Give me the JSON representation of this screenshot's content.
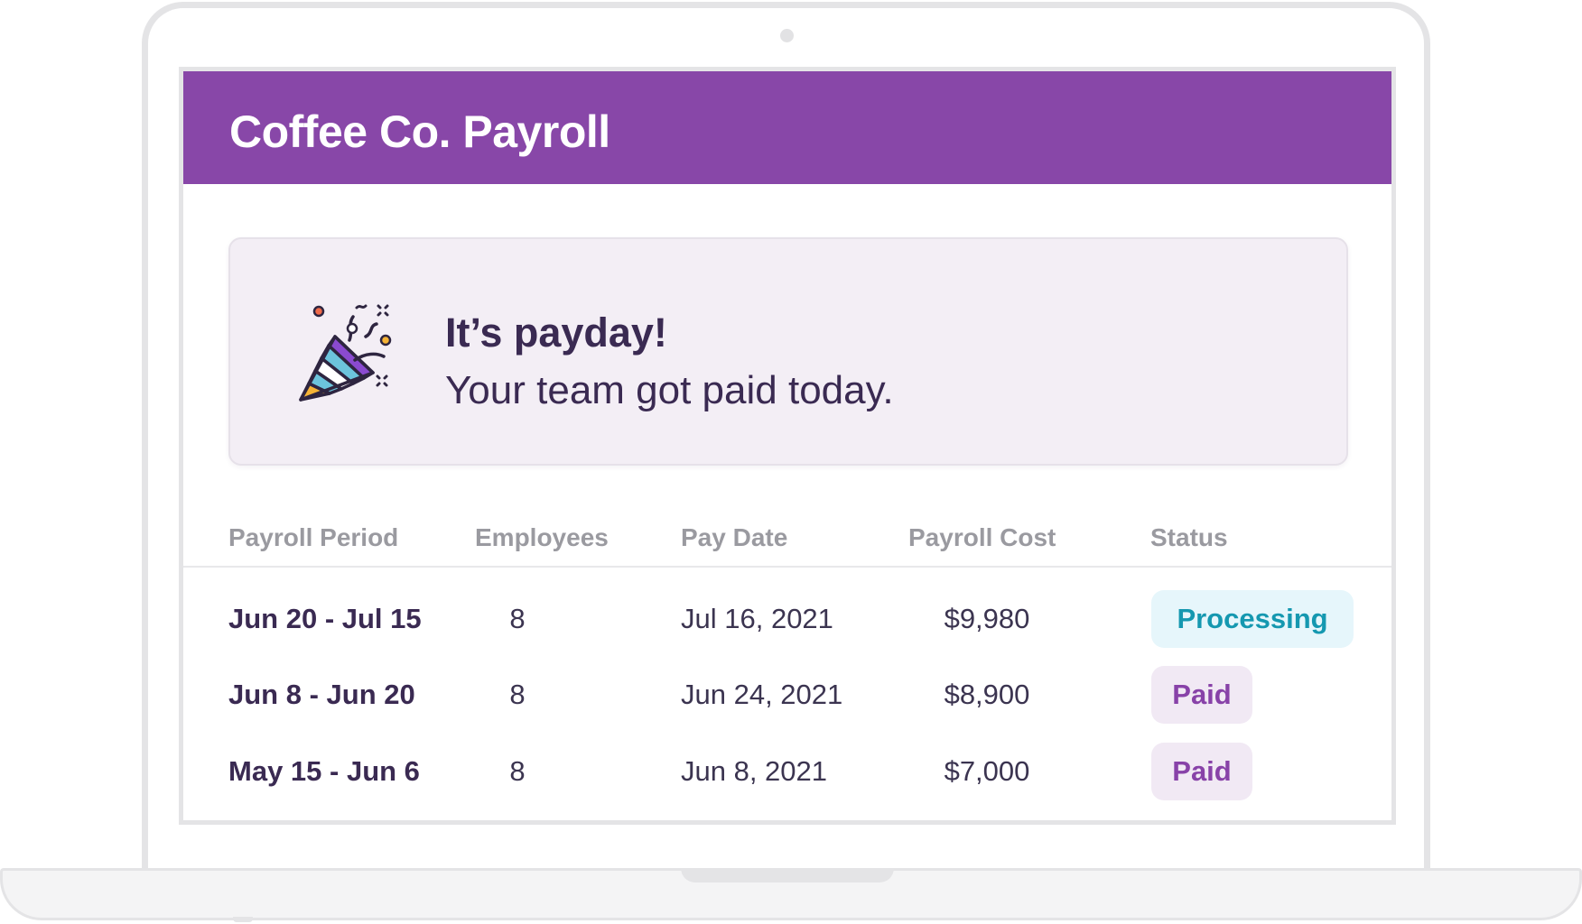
{
  "app": {
    "title": "Coffee Co. Payroll"
  },
  "banner": {
    "icon": "party-popper-icon",
    "title": "It’s payday!",
    "subtitle": "Your team got paid today."
  },
  "table": {
    "columns": [
      "Payroll Period",
      "Employees",
      "Pay Date",
      "Payroll Cost",
      "Status"
    ],
    "rows": [
      {
        "period": "Jun 20 - Jul 15",
        "employees": "8",
        "pay_date": "Jul 16, 2021",
        "cost": "$9,980",
        "status": "Processing"
      },
      {
        "period": "Jun 8 - Jun 20",
        "employees": "8",
        "pay_date": "Jun 24, 2021",
        "cost": "$8,900",
        "status": "Paid"
      },
      {
        "period": "May 15 - Jun 6",
        "employees": "8",
        "pay_date": "Jun 8, 2021",
        "cost": "$7,000",
        "status": "Paid"
      }
    ]
  },
  "colors": {
    "header": "#8847a8",
    "banner_bg": "#f3eef5",
    "heading_text": "#3a2a52",
    "processing_text": "#1598b0",
    "processing_bg": "#e6f6fb",
    "paid_text": "#8842a8",
    "paid_bg": "#f1e9f4"
  }
}
